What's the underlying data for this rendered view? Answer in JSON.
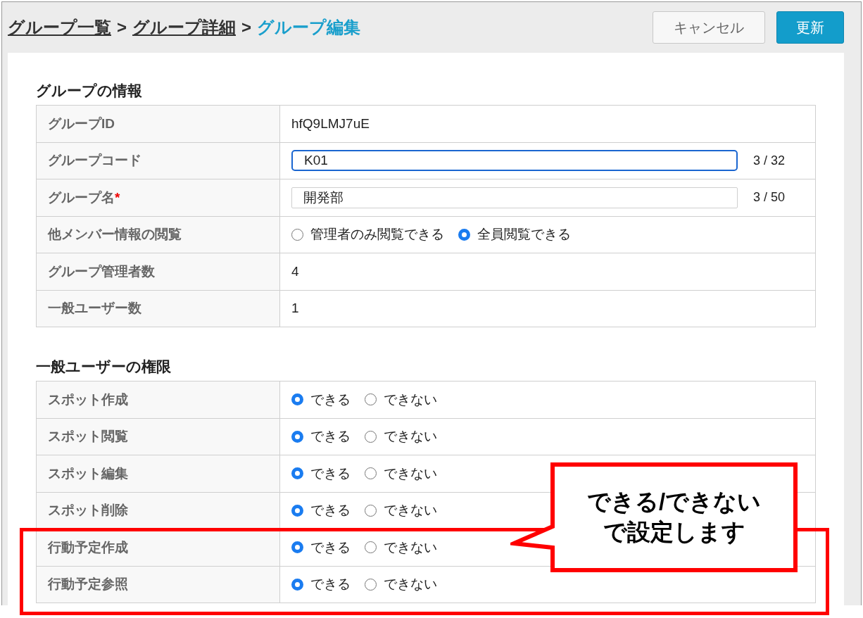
{
  "breadcrumb": [
    {
      "label": "グループ一覧",
      "kind": "link"
    },
    {
      "label": ">",
      "kind": "separator"
    },
    {
      "label": "グループ詳細",
      "kind": "link"
    },
    {
      "label": ">",
      "kind": "separator"
    },
    {
      "label": "グループ編集",
      "kind": "current"
    }
  ],
  "buttons": [
    {
      "label": "キャンセル",
      "kind": "secondary"
    },
    {
      "label": "更新",
      "kind": "primary"
    }
  ],
  "sections": [
    {
      "title": "グループの情報",
      "rows": [
        {
          "kind": "text",
          "label": "グループID",
          "value": "hfQ9LMJ7uE"
        },
        {
          "kind": "input",
          "label": "グループコード",
          "value": "K01",
          "counter": "3 / 32",
          "focused": true
        },
        {
          "kind": "input",
          "label": "グループ名",
          "required_mark": "*",
          "value": "開発部",
          "counter": "3 / 50",
          "focused": false
        },
        {
          "kind": "radio",
          "label": "他メンバー情報の閲覧",
          "options": [
            {
              "label": "管理者のみ閲覧できる",
              "selected": false
            },
            {
              "label": "全員閲覧できる",
              "selected": true
            }
          ]
        },
        {
          "kind": "text",
          "label": "グループ管理者数",
          "value": "4"
        },
        {
          "kind": "text",
          "label": "一般ユーザー数",
          "value": "1"
        }
      ]
    },
    {
      "title": "一般ユーザーの権限",
      "rows": [
        {
          "kind": "radio",
          "label": "スポット作成",
          "options": [
            {
              "label": "できる",
              "selected": true
            },
            {
              "label": "できない",
              "selected": false
            }
          ]
        },
        {
          "kind": "radio",
          "label": "スポット閲覧",
          "options": [
            {
              "label": "できる",
              "selected": true
            },
            {
              "label": "できない",
              "selected": false
            }
          ]
        },
        {
          "kind": "radio",
          "label": "スポット編集",
          "options": [
            {
              "label": "できる",
              "selected": true
            },
            {
              "label": "できない",
              "selected": false
            }
          ]
        },
        {
          "kind": "radio",
          "label": "スポット削除",
          "options": [
            {
              "label": "できる",
              "selected": true
            },
            {
              "label": "できない",
              "selected": false
            }
          ]
        },
        {
          "kind": "radio",
          "label": "行動予定作成",
          "options": [
            {
              "label": "できる",
              "selected": true
            },
            {
              "label": "できない",
              "selected": false
            }
          ]
        },
        {
          "kind": "radio",
          "label": "行動予定参照",
          "options": [
            {
              "label": "できる",
              "selected": true
            },
            {
              "label": "できない",
              "selected": false
            }
          ]
        }
      ]
    }
  ],
  "callout": {
    "lines": [
      "できる/できない",
      "で設定します"
    ]
  }
}
